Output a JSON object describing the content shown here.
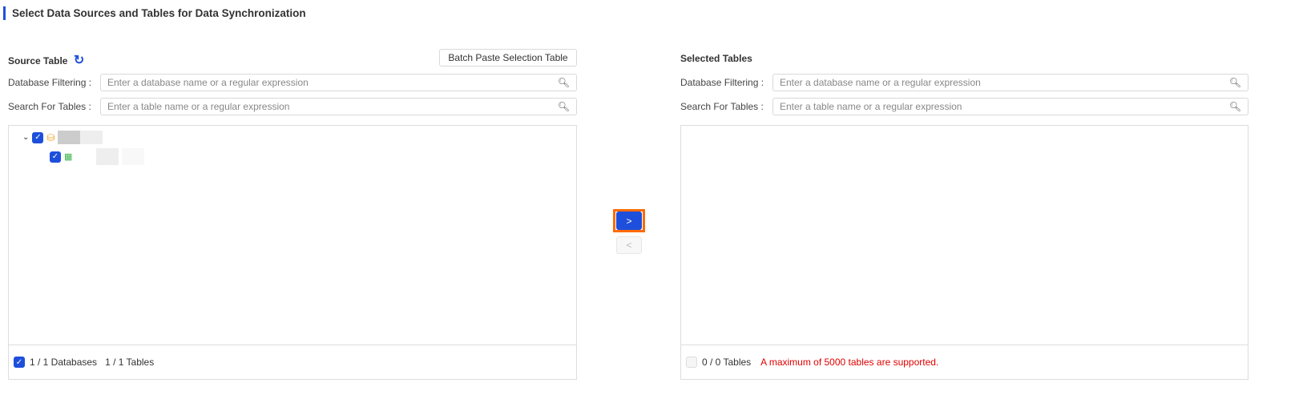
{
  "title": "Select Data Sources and Tables for Data Synchronization",
  "source": {
    "header": "Source Table",
    "batch_paste": "Batch Paste Selection Table",
    "db_filter_label": "Database Filtering :",
    "db_filter_placeholder": "Enter a database name or a regular expression",
    "table_search_label": "Search For Tables :",
    "table_search_placeholder": "Enter a table name or a regular expression",
    "footer_dbs": "1 / 1 Databases",
    "footer_tables": "1 / 1 Tables"
  },
  "transfer": {
    "right": ">",
    "left": "<"
  },
  "selected": {
    "header": "Selected Tables",
    "db_filter_label": "Database Filtering :",
    "db_filter_placeholder": "Enter a database name or a regular expression",
    "table_search_label": "Search For Tables :",
    "table_search_placeholder": "Enter a table name or a regular expression",
    "footer_tables": "0 / 0 Tables",
    "warning": "A maximum of 5000 tables are supported."
  },
  "colors": {
    "accent": "#1e4fdc",
    "highlight": "#ff6a00",
    "warning": "#e00000"
  }
}
